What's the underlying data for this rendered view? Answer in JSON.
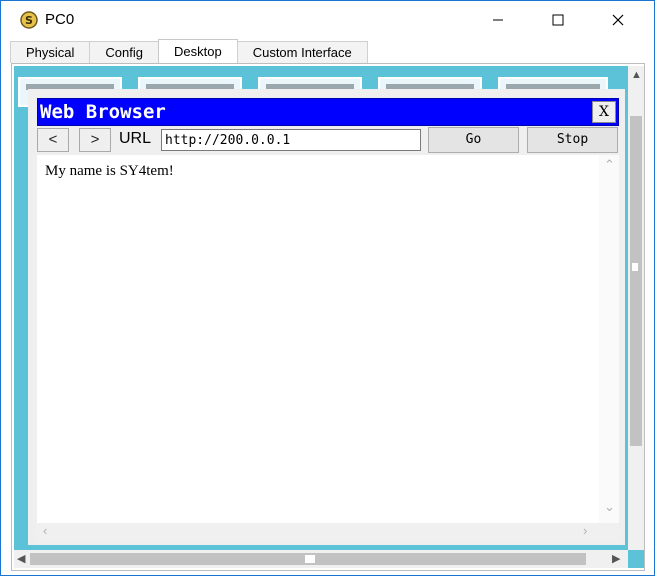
{
  "window": {
    "title": "PC0",
    "icon": "pc-app-icon"
  },
  "tabs": [
    {
      "label": "Physical"
    },
    {
      "label": "Config"
    },
    {
      "label": "Desktop",
      "active": true
    },
    {
      "label": "Custom Interface"
    }
  ],
  "browser": {
    "title": "Web Browser",
    "close_label": "X",
    "back_label": "<",
    "forward_label": ">",
    "url_label": "URL",
    "url_value": "http://200.0.0.1",
    "go_label": "Go",
    "stop_label": "Stop",
    "content_text": "My name is SY4tem!"
  },
  "colors": {
    "title_bar": "#0000ff",
    "desktop_bg": "#5cc2d7",
    "window_border": "#1a75d2"
  }
}
